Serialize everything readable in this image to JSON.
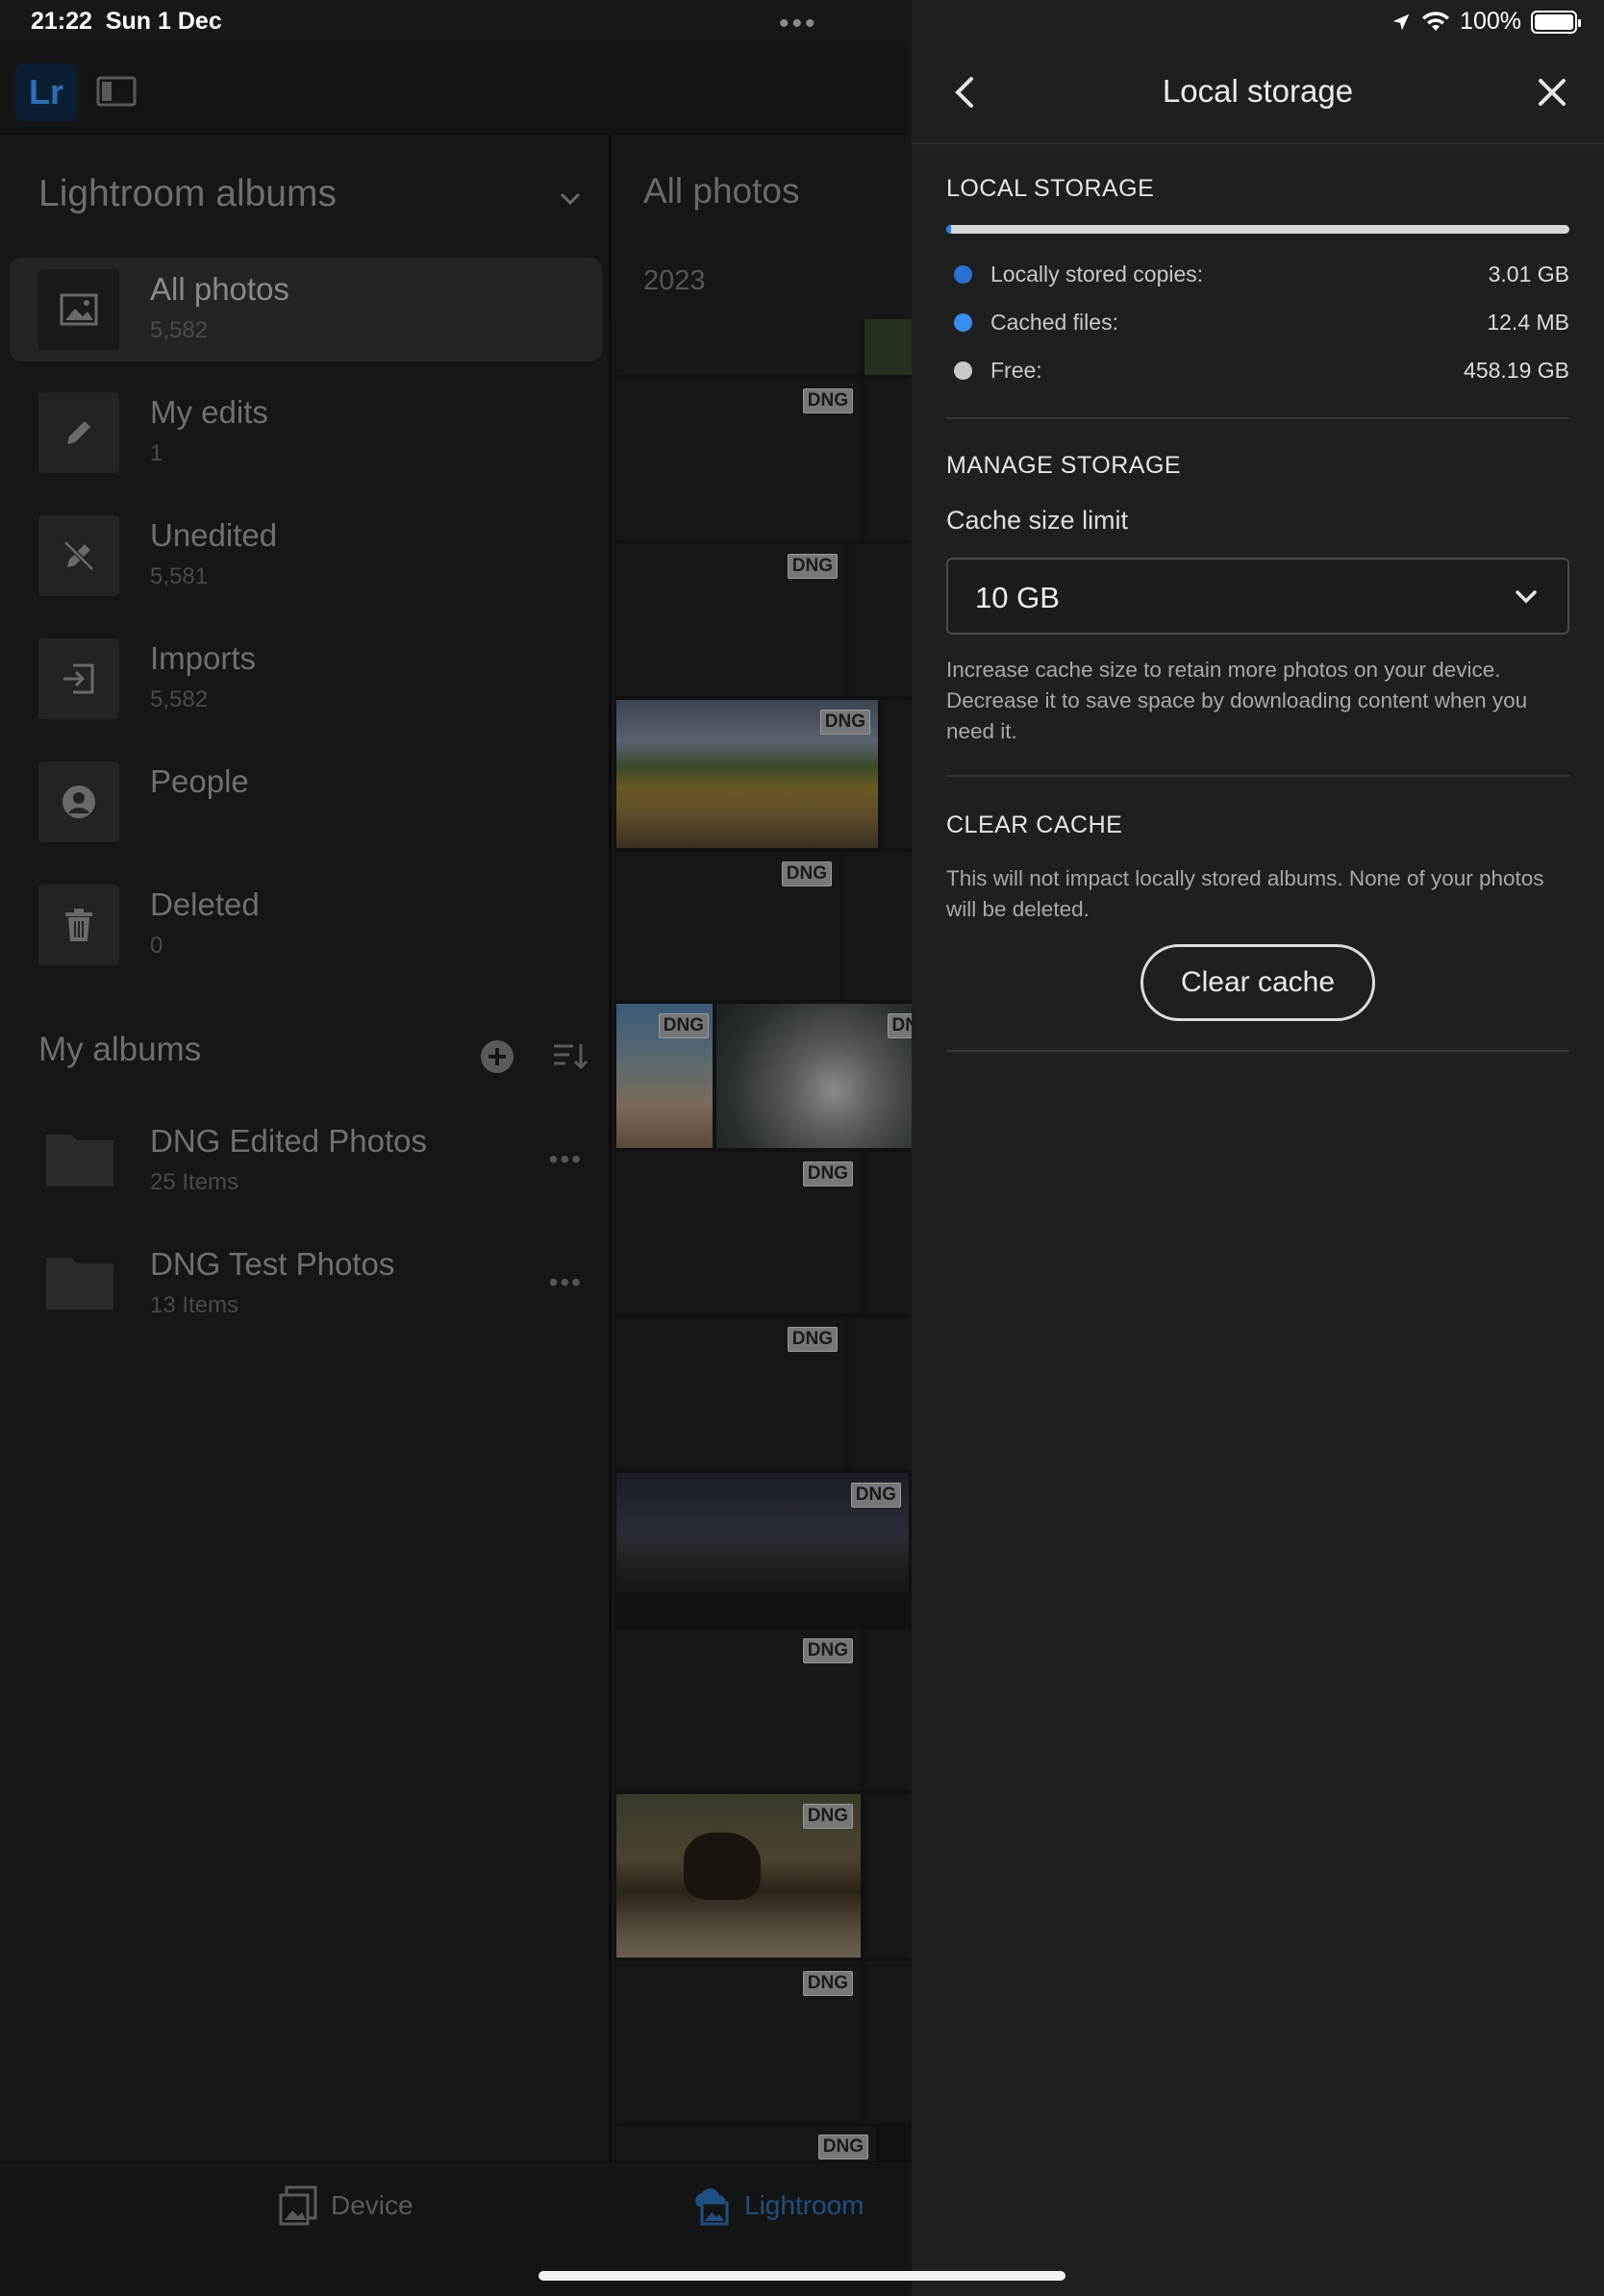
{
  "status_bar": {
    "time": "21:22",
    "date": "Sun 1 Dec",
    "more": "•••",
    "battery": "100%"
  },
  "app": {
    "logo": "Lr",
    "lightroom_albums": {
      "title": "Lightroom albums",
      "items": [
        {
          "name": "All photos",
          "count": "5,582",
          "icon": "image-icon",
          "selected": true
        },
        {
          "name": "My edits",
          "count": "1",
          "icon": "pencil-icon"
        },
        {
          "name": "Unedited",
          "count": "5,581",
          "icon": "pencil-off-icon"
        },
        {
          "name": "Imports",
          "count": "5,582",
          "icon": "import-icon"
        },
        {
          "name": "People",
          "count": "",
          "icon": "person-icon"
        },
        {
          "name": "Deleted",
          "count": "0",
          "icon": "trash-icon"
        }
      ]
    },
    "my_albums": {
      "title": "My albums",
      "items": [
        {
          "name": "DNG Edited Photos",
          "count": "25 Items"
        },
        {
          "name": "DNG Test Photos",
          "count": "13 Items"
        }
      ]
    },
    "grid": {
      "title": "All photos",
      "year": "2023",
      "badge": "DNG",
      "partial_badge": "DN"
    },
    "bottom_tabs": {
      "device": "Device",
      "lightroom": "Lightroom"
    }
  },
  "panel": {
    "title": "Local storage",
    "local_storage": {
      "heading": "LOCAL STORAGE",
      "used_fraction": 0.007,
      "rows": [
        {
          "label": "Locally stored copies:",
          "value": "3.01 GB",
          "color": "#2b6fd4"
        },
        {
          "label": "Cached files:",
          "value": "12.4 MB",
          "color": "#378ef0"
        },
        {
          "label": "Free:",
          "value": "458.19 GB",
          "color": "#c8c8c8"
        }
      ]
    },
    "manage_storage": {
      "heading": "MANAGE STORAGE",
      "field_label": "Cache size limit",
      "selected": "10 GB",
      "help": "Increase cache size to retain more photos on your device. Decrease it to save space by downloading content when you need it."
    },
    "clear_cache": {
      "heading": "CLEAR CACHE",
      "help": "This will not impact locally stored albums. None of your photos will be deleted.",
      "button": "Clear cache"
    }
  },
  "colors": {
    "accent": "#2680eb",
    "panel_bg": "#1f1f1f",
    "app_bg": "#161616"
  }
}
